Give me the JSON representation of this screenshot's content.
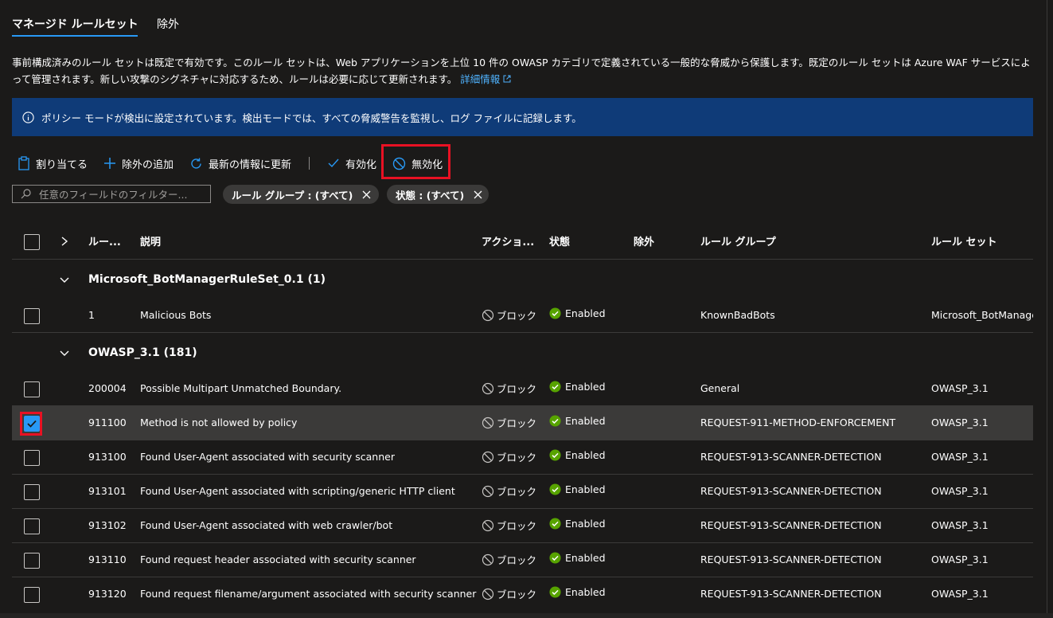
{
  "tabs": {
    "managed": "マネージド ルールセット",
    "exclusions": "除外"
  },
  "description": {
    "text": "事前構成済みのルール セットは既定で有効です。このルール セットは、Web アプリケーションを上位 10 件の OWASP カテゴリで定義されている一般的な脅威から保護します。既定のルール セットは Azure WAF サービスによって管理されます。新しい攻撃のシグネチャに対応するため、ルールは必要に応じて更新されます。",
    "link": "詳細情報"
  },
  "info_bar": {
    "text": "ポリシー モードが検出に設定されています。検出モードでは、すべての脅威警告を監視し、ログ ファイルに記録します。"
  },
  "toolbar": {
    "assign": "割り当てる",
    "add_exclusion": "除外の追加",
    "refresh": "最新の情報に更新",
    "enable": "有効化",
    "disable": "無効化"
  },
  "filter": {
    "placeholder": "任意のフィールドのフィルター...",
    "pill_rule_group": "ルール グループ : (すべて)",
    "pill_status": "状態 : (すべて)"
  },
  "columns": {
    "rule_id": "ルー...",
    "description": "説明",
    "action": "アクショ...",
    "status": "状態",
    "exclusions": "除外",
    "rule_group": "ルール グループ",
    "rule_set": "ルール セット"
  },
  "groups": [
    {
      "name": "Microsoft_BotManagerRuleSet_0.1 (1)",
      "rows": [
        {
          "id": "1",
          "description": "Malicious Bots",
          "action": "ブロック",
          "status": "Enabled",
          "rule_group": "KnownBadBots",
          "rule_set": "Microsoft_BotManager",
          "selected": false
        }
      ]
    },
    {
      "name": "OWASP_3.1 (181)",
      "rows": [
        {
          "id": "200004",
          "description": "Possible Multipart Unmatched Boundary.",
          "action": "ブロック",
          "status": "Enabled",
          "rule_group": "General",
          "rule_set": "OWASP_3.1",
          "selected": false
        },
        {
          "id": "911100",
          "description": "Method is not allowed by policy",
          "action": "ブロック",
          "status": "Enabled",
          "rule_group": "REQUEST-911-METHOD-ENFORCEMENT",
          "rule_set": "OWASP_3.1",
          "selected": true
        },
        {
          "id": "913100",
          "description": "Found User-Agent associated with security scanner",
          "action": "ブロック",
          "status": "Enabled",
          "rule_group": "REQUEST-913-SCANNER-DETECTION",
          "rule_set": "OWASP_3.1",
          "selected": false
        },
        {
          "id": "913101",
          "description": "Found User-Agent associated with scripting/generic HTTP client",
          "action": "ブロック",
          "status": "Enabled",
          "rule_group": "REQUEST-913-SCANNER-DETECTION",
          "rule_set": "OWASP_3.1",
          "selected": false
        },
        {
          "id": "913102",
          "description": "Found User-Agent associated with web crawler/bot",
          "action": "ブロック",
          "status": "Enabled",
          "rule_group": "REQUEST-913-SCANNER-DETECTION",
          "rule_set": "OWASP_3.1",
          "selected": false
        },
        {
          "id": "913110",
          "description": "Found request header associated with security scanner",
          "action": "ブロック",
          "status": "Enabled",
          "rule_group": "REQUEST-913-SCANNER-DETECTION",
          "rule_set": "OWASP_3.1",
          "selected": false
        },
        {
          "id": "913120",
          "description": "Found request filename/argument associated with security scanner",
          "action": "ブロック",
          "status": "Enabled",
          "rule_group": "REQUEST-913-SCANNER-DETECTION",
          "rule_set": "OWASP_3.1",
          "selected": false
        }
      ]
    }
  ],
  "colors": {
    "accent": "#2899f5",
    "info_bg": "#0f3b78",
    "highlight": "#e81123",
    "success": "#57a300"
  }
}
